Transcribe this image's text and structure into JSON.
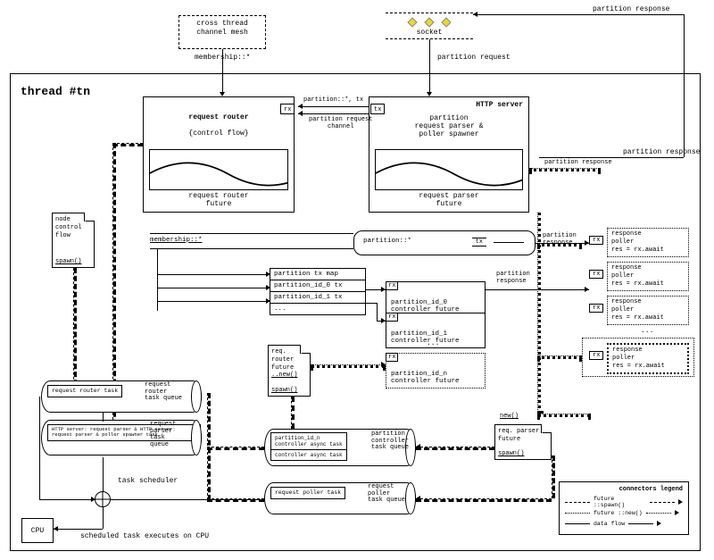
{
  "top": {
    "cross_thread": "cross thread\nchannel mesh",
    "membership": "membership::*",
    "socket": "socket",
    "partition_request": "partition request",
    "partition_response": "partition response"
  },
  "thread": {
    "title": "thread #tn"
  },
  "router": {
    "title": "request router",
    "control_flow": "{control flow}",
    "future": "request router\nfuture"
  },
  "channel": {
    "label": "partition request\nchannel",
    "rxtx": "partition::*, tx",
    "rx": "rx",
    "tx": "tx"
  },
  "server": {
    "title": "HTTP server",
    "sub": "partition\nrequest parser &\npoller spawner",
    "future": "request parser\nfuture"
  },
  "node_note": {
    "l1": "node",
    "l2": "control",
    "l3": "flow",
    "spawn": "spawn()"
  },
  "membership_row": "membership::*",
  "partition_star": "partition::*",
  "tx_chip": "tx",
  "partition_response_right": "partition\nresponse",
  "partition_response_dotted": "partition response",
  "txmap": {
    "title": "partition tx map",
    "r0": "partition_id_0 tx",
    "r1": "partition_id_1 tx",
    "r2": "..."
  },
  "controllers": {
    "c0": "partition_id_0\ncontroller future",
    "c1": "partition_id_1\ncontroller future",
    "dots": "...",
    "cn": "partition_id_n\ncontroller future",
    "rx": "rx",
    "resp_label": "partition\nresponse"
  },
  "req_note": {
    "l1": "req.",
    "l2": "router",
    "l3": "future",
    "l4": "..new()",
    "spawn": "spawn()"
  },
  "parser_note": {
    "l1": "req. parser",
    "l2": "future",
    "spawn": "spawn()",
    "new": "new()"
  },
  "queues": {
    "router": {
      "inner": "request router task",
      "label": "request\nrouter\ntask queue"
    },
    "parser": {
      "inner": "HTTP server: request parser &\nHTTP server: request parser &\npoller spawner task",
      "label": "request\nparser\ntask\nqueue"
    },
    "partition": {
      "inner_top": "partition_id_n\ncontroller async task",
      "inner_bot": "controller async task",
      "label": "partition\ncontroller\ntask queue"
    },
    "poller": {
      "inner": "request poller task",
      "label": "request\npoller\ntask queue"
    }
  },
  "scheduler": {
    "label": "task scheduler",
    "exec": "scheduled task executes on CPU"
  },
  "cpu": "CPU",
  "pollers": {
    "title": "response\npoller",
    "res": "res = rx.await",
    "rx": "rx",
    "dots": "..."
  },
  "legend": {
    "title": "connectors legend",
    "spawn": "future ::spawn()",
    "new": "future ::new()",
    "data": "data flow"
  }
}
